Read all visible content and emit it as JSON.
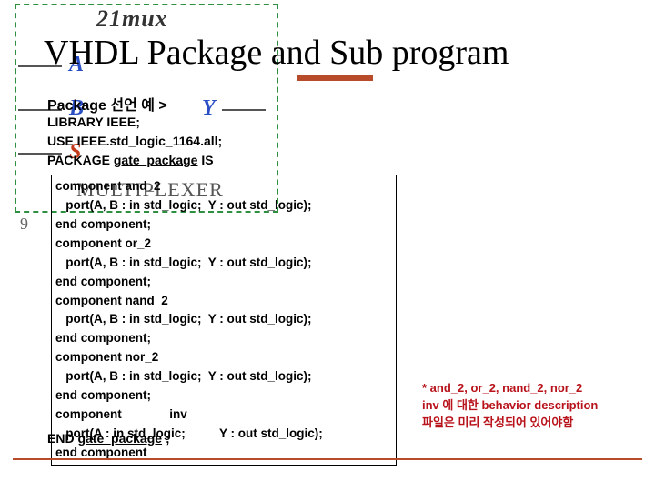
{
  "bg": {
    "label_top": "21mux",
    "port_a": "A",
    "port_b": "B",
    "port_s": "S",
    "port_y": "Y",
    "mux": "MULTIPLEXER",
    "page_num": "9"
  },
  "title": "VHDL Package and Sub program",
  "subtitle": "Package 선언 예 >",
  "pre": {
    "l1": "LIBRARY IEEE;",
    "l2": "USE IEEE.std_logic_1164.all;",
    "l3a": "PACKAGE ",
    "l3b": "gate_package",
    "l3c": " IS"
  },
  "code": {
    "l1": "component and_2",
    "l2": "   port(A, B : in std_logic;  Y : out std_logic);",
    "l3": "end component;",
    "l4": "component or_2",
    "l5": "   port(A, B : in std_logic;  Y : out std_logic);",
    "l6": "end component;",
    "l7": "component nand_2",
    "l8": "   port(A, B : in std_logic;  Y : out std_logic);",
    "l9": "end component;",
    "l10": "component nor_2",
    "l11": "   port(A, B : in std_logic;  Y : out std_logic);",
    "l12": "end component;",
    "l13": "component              inv",
    "l14": "   port(A : in std_logic;          Y : out std_logic);",
    "l15": "end component"
  },
  "endline": {
    "a": "END ",
    "b": "gate_package",
    "c": " ;"
  },
  "note": {
    "l1": "* and_2, or_2, nand_2, nor_2",
    "l2": "  inv 에 대한 behavior description",
    "l3": "  파일은 미리 작성되어 있어야함"
  }
}
